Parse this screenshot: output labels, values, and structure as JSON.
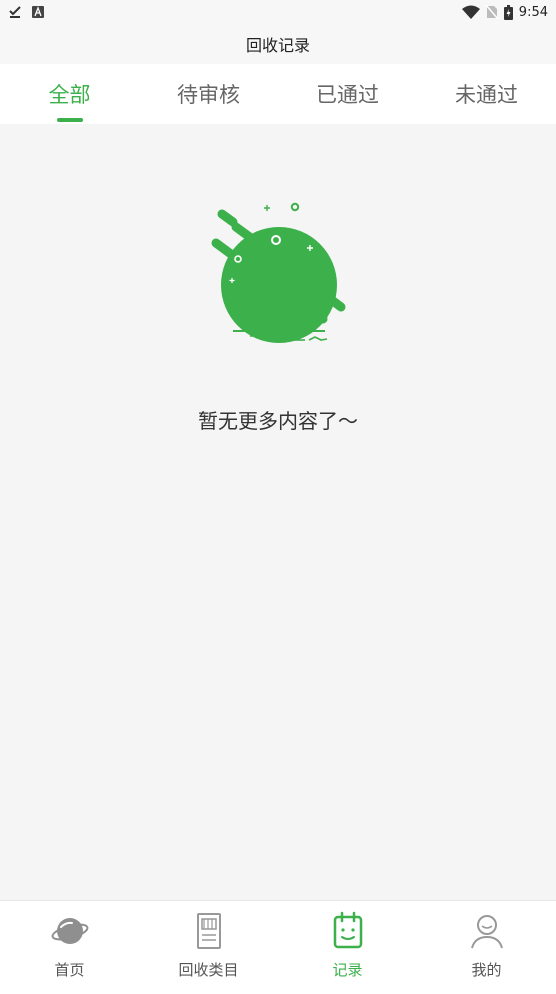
{
  "status_bar": {
    "time": "9:54"
  },
  "header": {
    "title": "回收记录"
  },
  "tabs": [
    {
      "label": "全部",
      "active": true
    },
    {
      "label": "待审核",
      "active": false
    },
    {
      "label": "已通过",
      "active": false
    },
    {
      "label": "未通过",
      "active": false
    }
  ],
  "empty_state": {
    "message": "暂无更多内容了～"
  },
  "bottom_nav": {
    "items": [
      {
        "label": "首页",
        "icon": "planet-icon",
        "active": false
      },
      {
        "label": "回收类目",
        "icon": "category-icon",
        "active": false
      },
      {
        "label": "记录",
        "icon": "record-icon",
        "active": true
      },
      {
        "label": "我的",
        "icon": "user-icon",
        "active": false
      }
    ]
  },
  "colors": {
    "accent": "#3cb04b",
    "tab_inactive": "#666666",
    "background": "#f5f5f5"
  }
}
